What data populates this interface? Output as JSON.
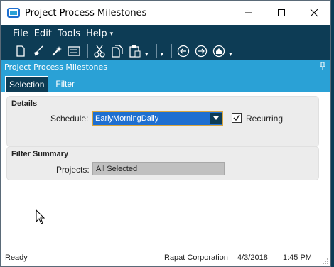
{
  "window": {
    "title": "Project Process Milestones"
  },
  "menu": {
    "items": [
      "File",
      "Edit",
      "Tools",
      "Help"
    ]
  },
  "toolbar": {
    "icons": [
      "new-document-icon",
      "clear-icon",
      "magic-wand-icon",
      "form-icon",
      "cut-icon",
      "copy-icon",
      "paste-icon",
      "back-icon",
      "forward-icon",
      "home-icon"
    ]
  },
  "panel": {
    "title": "Project Process Milestones"
  },
  "tabs": [
    {
      "label": "Selection",
      "active": true
    },
    {
      "label": "Filter",
      "active": false
    }
  ],
  "details": {
    "title": "Details",
    "schedule_label": "Schedule:",
    "schedule_value": "EarlyMorningDaily",
    "recurring_label": "Recurring",
    "recurring_checked": true
  },
  "filter_summary": {
    "title": "Filter Summary",
    "projects_label": "Projects:",
    "projects_value": "All Selected"
  },
  "status": {
    "left": "Ready",
    "company": "Rapat Corporation",
    "date": "4/3/2018",
    "time": "1:45 PM"
  },
  "colors": {
    "menu_bg": "#0d3c55",
    "panel_header": "#2aa1d6",
    "select_bg": "#1e6fd0",
    "select_border": "#d8a640"
  }
}
